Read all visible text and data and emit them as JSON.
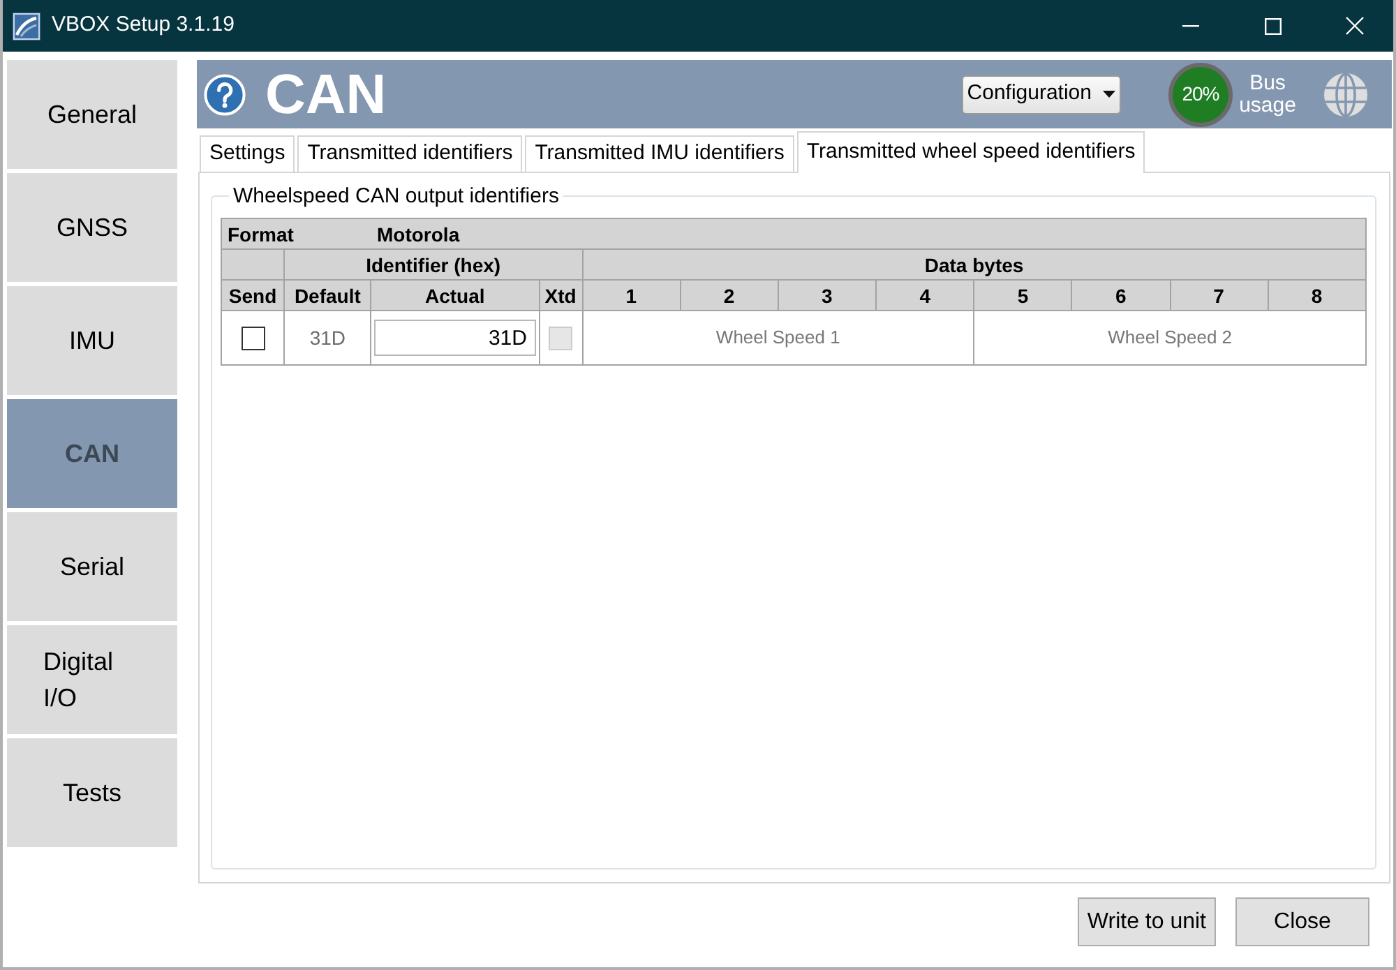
{
  "window": {
    "title": "VBOX Setup 3.1.19"
  },
  "sidebar": {
    "items": [
      {
        "label": "General",
        "selected": false
      },
      {
        "label": "GNSS",
        "selected": false
      },
      {
        "label": "IMU",
        "selected": false
      },
      {
        "label": "CAN",
        "selected": true
      },
      {
        "label": "Serial",
        "selected": false
      },
      {
        "label": "Digital I/O",
        "selected": false
      },
      {
        "label": "Tests",
        "selected": false
      }
    ]
  },
  "header": {
    "title": "CAN",
    "dropdown": {
      "value": "Configuration"
    },
    "bus_usage": {
      "reading": "20%",
      "label": "Bus usage"
    }
  },
  "tabs": [
    {
      "label": "Settings",
      "selected": false
    },
    {
      "label": "Transmitted identifiers",
      "selected": false
    },
    {
      "label": "Transmitted IMU identifiers",
      "selected": false
    },
    {
      "label": "Transmitted wheel speed identifiers",
      "selected": true
    }
  ],
  "group": {
    "title": "Wheelspeed CAN output identifiers",
    "table": {
      "format_label": "Format",
      "format_value": "Motorola",
      "group_headers": [
        "Identifier (hex)",
        "Data bytes"
      ],
      "columns": [
        {
          "label": "Send",
          "kind": "send"
        },
        {
          "label": "Default",
          "kind": "default"
        },
        {
          "label": "Actual",
          "kind": "actual"
        },
        {
          "label": "Xtd",
          "kind": "xtd"
        },
        {
          "label": "1",
          "kind": "byte"
        },
        {
          "label": "2",
          "kind": "byte"
        },
        {
          "label": "3",
          "kind": "byte"
        },
        {
          "label": "4",
          "kind": "byte"
        },
        {
          "label": "5",
          "kind": "byte"
        },
        {
          "label": "6",
          "kind": "byte"
        },
        {
          "label": "7",
          "kind": "byte"
        },
        {
          "label": "8",
          "kind": "byte"
        }
      ],
      "rows": [
        {
          "send": {
            "checked": false
          },
          "default": "31D",
          "actual": "31D",
          "xtd": {
            "checked": false,
            "disabled": true
          },
          "signals": [
            "Wheel Speed 1",
            "Wheel Speed 2"
          ]
        }
      ]
    }
  },
  "buttons": [
    "Write to unit",
    "Close"
  ]
}
